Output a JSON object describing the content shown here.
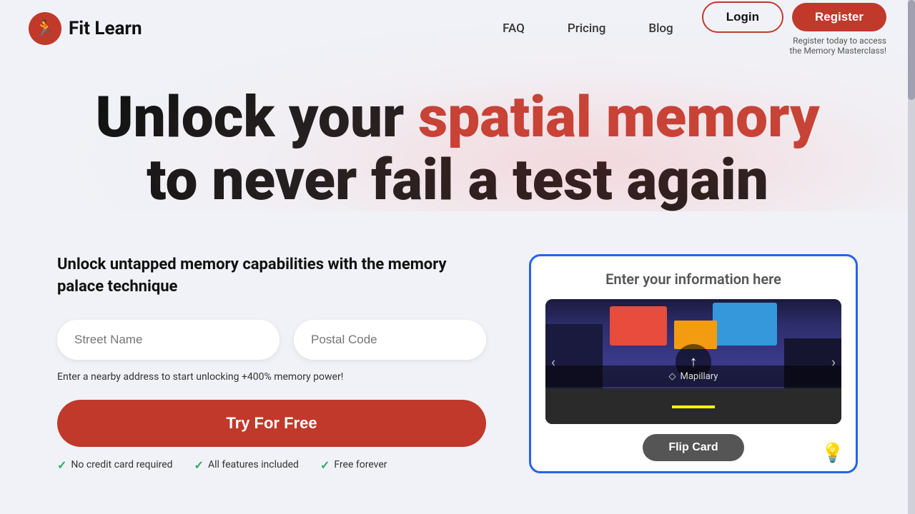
{
  "logo": {
    "icon": "🏃",
    "text": "Fit Learn"
  },
  "nav": {
    "links": [
      {
        "label": "FAQ",
        "id": "faq"
      },
      {
        "label": "Pricing",
        "id": "pricing"
      },
      {
        "label": "Blog",
        "id": "blog"
      }
    ],
    "login_label": "Login",
    "register_label": "Register",
    "register_sub1": "Register today to access",
    "register_sub2": "the Memory Masterclass!"
  },
  "hero": {
    "title_part1": "Unlock your ",
    "title_highlight": "spatial memory",
    "title_part2": "to never fail a test again"
  },
  "left": {
    "subtitle": "Unlock untapped memory capabilities with the memory palace technique",
    "street_placeholder": "Street Name",
    "postal_placeholder": "Postal Code",
    "address_hint": "Enter a nearby address to start unlocking +400% memory power!",
    "try_button": "Try For Free",
    "features": [
      {
        "label": "No credit card required"
      },
      {
        "label": "All features included"
      },
      {
        "label": "Free forever"
      }
    ]
  },
  "right": {
    "header": "Enter your information here",
    "mapillary_label": "Mapillary",
    "flip_button": "Flip Card",
    "bulb": "💡"
  }
}
